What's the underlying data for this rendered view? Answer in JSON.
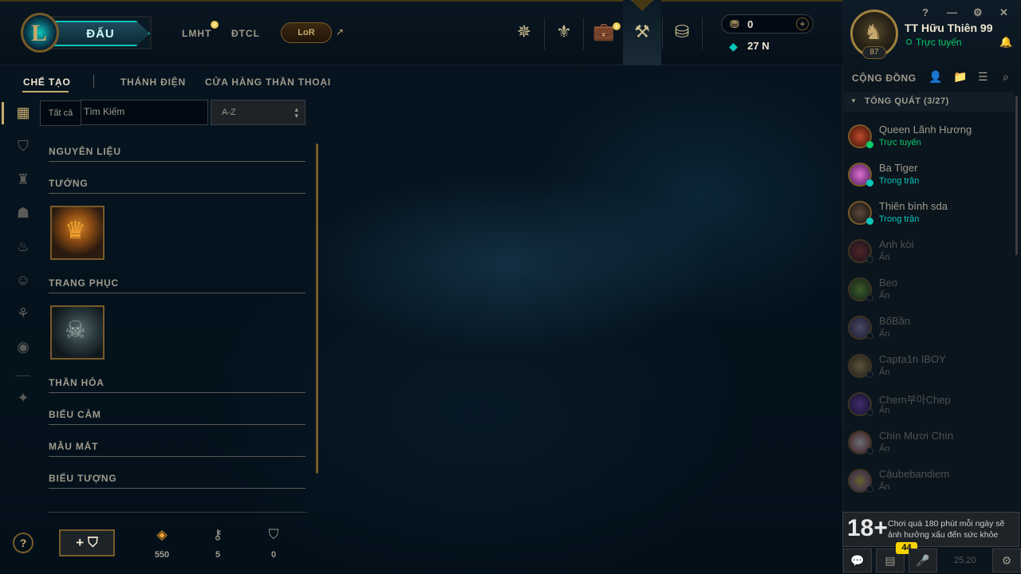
{
  "header": {
    "logo_letter": "L",
    "play_label": "ĐẤU",
    "links": [
      "LMHT",
      "ĐTCL"
    ],
    "lor_label": "LoR",
    "rp_value": "0",
    "be_value": "27 N",
    "icons": [
      "shield-icon",
      "trophy-icon",
      "chest-icon",
      "crafting-icon",
      "store-icon"
    ]
  },
  "profile": {
    "name": "TT Hữu Thiên 99",
    "status": "Trực tuyến",
    "level": "87"
  },
  "window_controls": [
    "?",
    "—",
    "⚙",
    "✕"
  ],
  "subnav": {
    "items": [
      "CHẾ TẠO",
      "THÁNH ĐIỆN",
      "CỬA HÀNG THẦN THOẠI"
    ]
  },
  "filters": {
    "tooltip": "Tất cả",
    "search_placeholder": "Tìm Kiếm",
    "sort_value": "A-Z"
  },
  "sections": [
    "NGUYÊN LIỆU",
    "TƯỚNG",
    "TRANG PHỤC",
    "THẦN HỎA",
    "BIỂU CẢM",
    "MẪU MẮT",
    "BIỂU TƯỢNG"
  ],
  "resources": {
    "orange_essence": "550",
    "keys": "5",
    "chests": "0"
  },
  "social": {
    "title": "CỘNG ĐỒNG",
    "group": "TỔNG QUÁT (3/27)",
    "friends": [
      {
        "name": "Queen Lãnh Hương",
        "status": "Trực tuyến"
      },
      {
        "name": "Ba Tiger",
        "status": "Trong trận"
      },
      {
        "name": "Thiên bình sda",
        "status": "Trong trận"
      },
      {
        "name": "Anh kòi",
        "status": "Ẩn"
      },
      {
        "name": "Beo",
        "status": "Ẩn"
      },
      {
        "name": "BốBần",
        "status": "Ẩn"
      },
      {
        "name": "Capta1n IBOY",
        "status": "Ẩn"
      },
      {
        "name": "Chem부아Chep",
        "status": "Ẩn"
      },
      {
        "name": "Chín Mươi Chín",
        "status": "Ẩn"
      },
      {
        "name": "Cậubebandiem",
        "status": "Ẩn"
      }
    ],
    "warning_age": "18+",
    "warning_text": "Chơi quá 180 phút mỗi ngày sẽ ảnh hưởng xấu đến sức khỏe",
    "notification_count": "44",
    "version": "25.20"
  },
  "colors": {
    "gold": "#c8aa6e",
    "teal": "#0ac8b9",
    "online": "#0acb6a",
    "in_game": "#0ac8b9"
  }
}
